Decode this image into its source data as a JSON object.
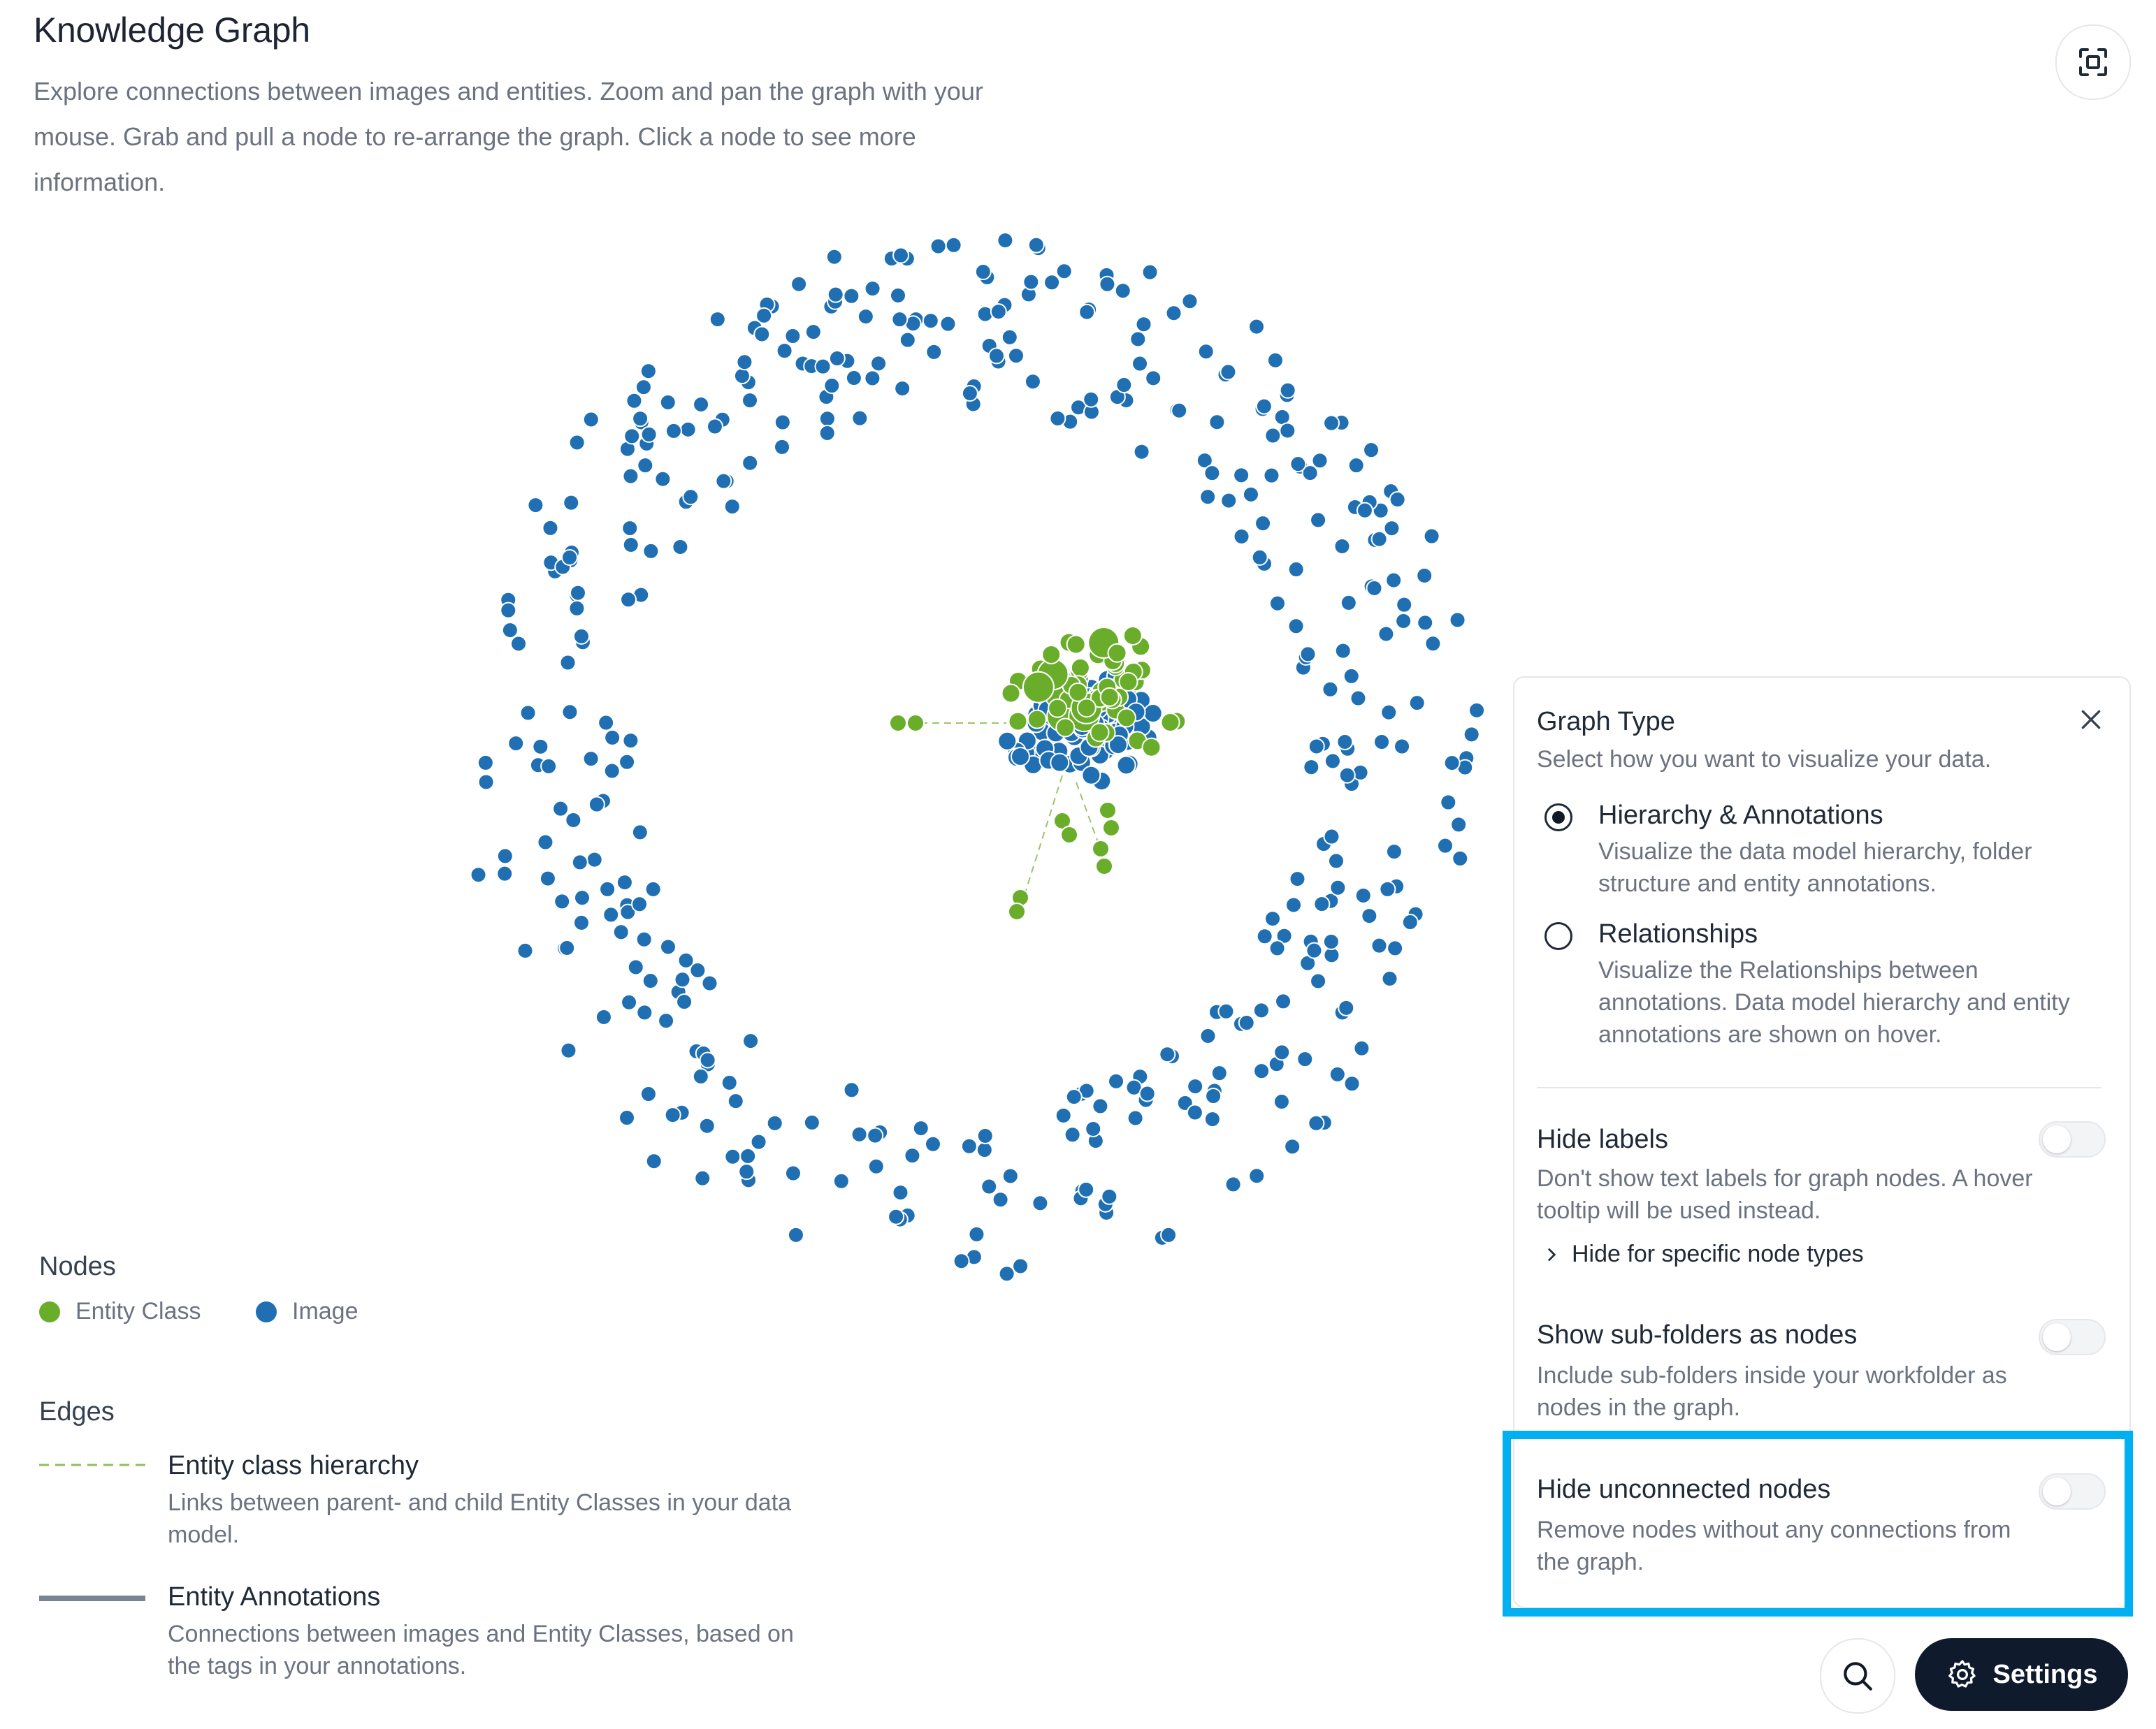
{
  "header": {
    "title": "Knowledge Graph",
    "subtitle": "Explore connections between images and entities. Zoom and pan the graph with your mouse. Grab and pull a node to re-arrange the graph. Click a node to see more information."
  },
  "fit_button_icon": "fit-screen-icon",
  "colors": {
    "entity_class": "#6aad2a",
    "image": "#1f6fb2",
    "accent_highlight": "#00b0f0",
    "settings_bg": "#0f1b2d"
  },
  "legend": {
    "nodes_heading": "Nodes",
    "node_types": [
      {
        "label": "Entity Class",
        "color": "#6aad2a"
      },
      {
        "label": "Image",
        "color": "#1f6fb2"
      }
    ],
    "edges_heading": "Edges",
    "edge_types": [
      {
        "title": "Entity class hierarchy",
        "style": "dashed",
        "description": "Links between parent- and child Entity Classes in your data model."
      },
      {
        "title": "Entity Annotations",
        "style": "solid",
        "description": "Connections between images and Entity Classes, based on the tags in your annotations."
      }
    ]
  },
  "settings_panel": {
    "graph_type_heading": "Graph Type",
    "graph_type_sub": "Select how you want to visualize your data.",
    "close_icon": "close-icon",
    "options": [
      {
        "title": "Hierarchy & Annotations",
        "description": "Visualize the data model hierarchy, folder structure and entity annotations.",
        "selected": true
      },
      {
        "title": "Relationships",
        "description": "Visualize the Relationships between annotations. Data model hierarchy and entity annotations are shown on hover.",
        "selected": false
      }
    ],
    "hide_labels": {
      "title": "Hide labels",
      "description": "Don't show text labels for graph nodes. A hover tooltip will be used instead.",
      "enabled": false,
      "expander": "Hide for specific node types"
    },
    "show_subfolders": {
      "title": "Show sub-folders as nodes",
      "description": "Include sub-folders inside your workfolder as nodes in the graph.",
      "enabled": false
    },
    "hide_unconnected": {
      "title": "Hide unconnected nodes",
      "description": "Remove nodes without any connections from the graph.",
      "enabled": false
    }
  },
  "bottom_bar": {
    "search_icon": "search-icon",
    "settings_icon": "gear-icon",
    "settings_label": "Settings"
  }
}
